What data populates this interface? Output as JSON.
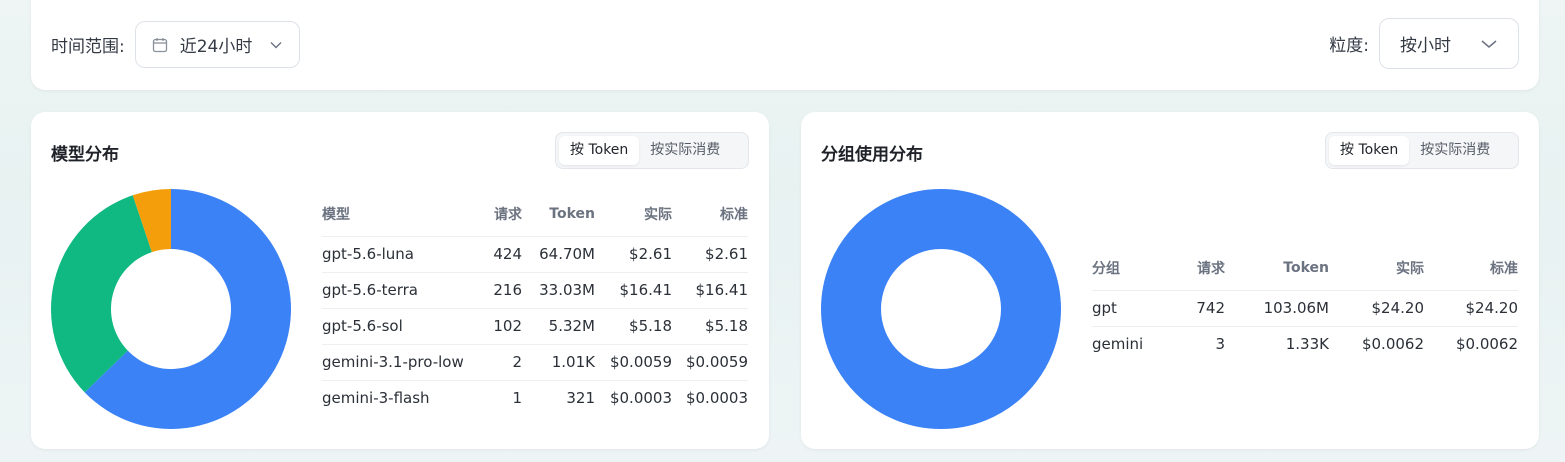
{
  "filters": {
    "time_range_label": "时间范围:",
    "time_range_value": "近24小时",
    "granularity_label": "粒度:",
    "granularity_value": "按小时"
  },
  "colors": {
    "blue": "#3b82f6",
    "green": "#10b981",
    "orange": "#f59e0b",
    "actual": "#16a34a",
    "standard": "#9ca3af"
  },
  "model_panel": {
    "title": "模型分布",
    "toggle": [
      "按 Token",
      "按实际消费"
    ],
    "active_toggle": "按 Token",
    "columns": [
      "模型",
      "请求",
      "Token",
      "实际",
      "标准"
    ],
    "rows": [
      {
        "name": "gpt-5.6-luna",
        "requests": "424",
        "tokens": "64.70M",
        "actual": "$2.61",
        "standard": "$2.61"
      },
      {
        "name": "gpt-5.6-terra",
        "requests": "216",
        "tokens": "33.03M",
        "actual": "$16.41",
        "standard": "$16.41"
      },
      {
        "name": "gpt-5.6-sol",
        "requests": "102",
        "tokens": "5.32M",
        "actual": "$5.18",
        "standard": "$5.18"
      },
      {
        "name": "gemini-3.1-pro-low",
        "requests": "2",
        "tokens": "1.01K",
        "actual": "$0.0059",
        "standard": "$0.0059"
      },
      {
        "name": "gemini-3-flash",
        "requests": "1",
        "tokens": "321",
        "actual": "$0.0003",
        "standard": "$0.0003"
      }
    ]
  },
  "group_panel": {
    "title": "分组使用分布",
    "toggle": [
      "按 Token",
      "按实际消费"
    ],
    "active_toggle": "按 Token",
    "columns": [
      "分组",
      "请求",
      "Token",
      "实际",
      "标准"
    ],
    "rows": [
      {
        "name": "gpt",
        "requests": "742",
        "tokens": "103.06M",
        "actual": "$24.20",
        "standard": "$24.20"
      },
      {
        "name": "gemini",
        "requests": "3",
        "tokens": "1.33K",
        "actual": "$0.0062",
        "standard": "$0.0062"
      }
    ]
  },
  "chart_data": [
    {
      "type": "pie",
      "title": "模型分布",
      "categories": [
        "gpt-5.6-luna",
        "gpt-5.6-terra",
        "gpt-5.6-sol",
        "gemini-3.1-pro-low",
        "gemini-3-flash"
      ],
      "values": [
        64700000,
        33030000,
        5320000,
        1010,
        321
      ],
      "colors": [
        "#3b82f6",
        "#10b981",
        "#f59e0b",
        "#ef4444",
        "#8b5cf6"
      ]
    },
    {
      "type": "pie",
      "title": "分组使用分布",
      "categories": [
        "gpt",
        "gemini"
      ],
      "values": [
        103060000,
        1330
      ],
      "colors": [
        "#3b82f6",
        "#10b981"
      ]
    }
  ]
}
